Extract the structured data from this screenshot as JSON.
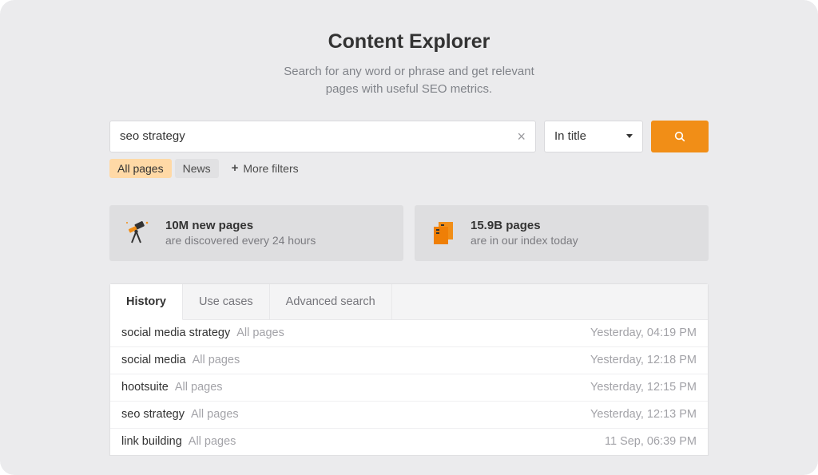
{
  "header": {
    "title": "Content Explorer",
    "subtitle_line1": "Search for any word or phrase and get relevant",
    "subtitle_line2": "pages with useful SEO metrics."
  },
  "search": {
    "value": "seo strategy",
    "scope": "In title"
  },
  "filters": {
    "all_pages": "All pages",
    "news": "News",
    "more": "More filters"
  },
  "stats": {
    "card1": {
      "title": "10M new pages",
      "sub": "are discovered every 24 hours"
    },
    "card2": {
      "title": "15.9B pages",
      "sub": "are in our index today"
    }
  },
  "tabs": {
    "history": "History",
    "use_cases": "Use cases",
    "advanced": "Advanced search"
  },
  "history": [
    {
      "query": "social media strategy",
      "scope": "All pages",
      "time": "Yesterday, 04:19 PM"
    },
    {
      "query": "social media",
      "scope": "All pages",
      "time": "Yesterday, 12:18 PM"
    },
    {
      "query": "hootsuite",
      "scope": "All pages",
      "time": "Yesterday, 12:15 PM"
    },
    {
      "query": "seo strategy",
      "scope": "All pages",
      "time": "Yesterday, 12:13 PM"
    },
    {
      "query": "link building",
      "scope": "All pages",
      "time": "11 Sep, 06:39 PM"
    }
  ]
}
